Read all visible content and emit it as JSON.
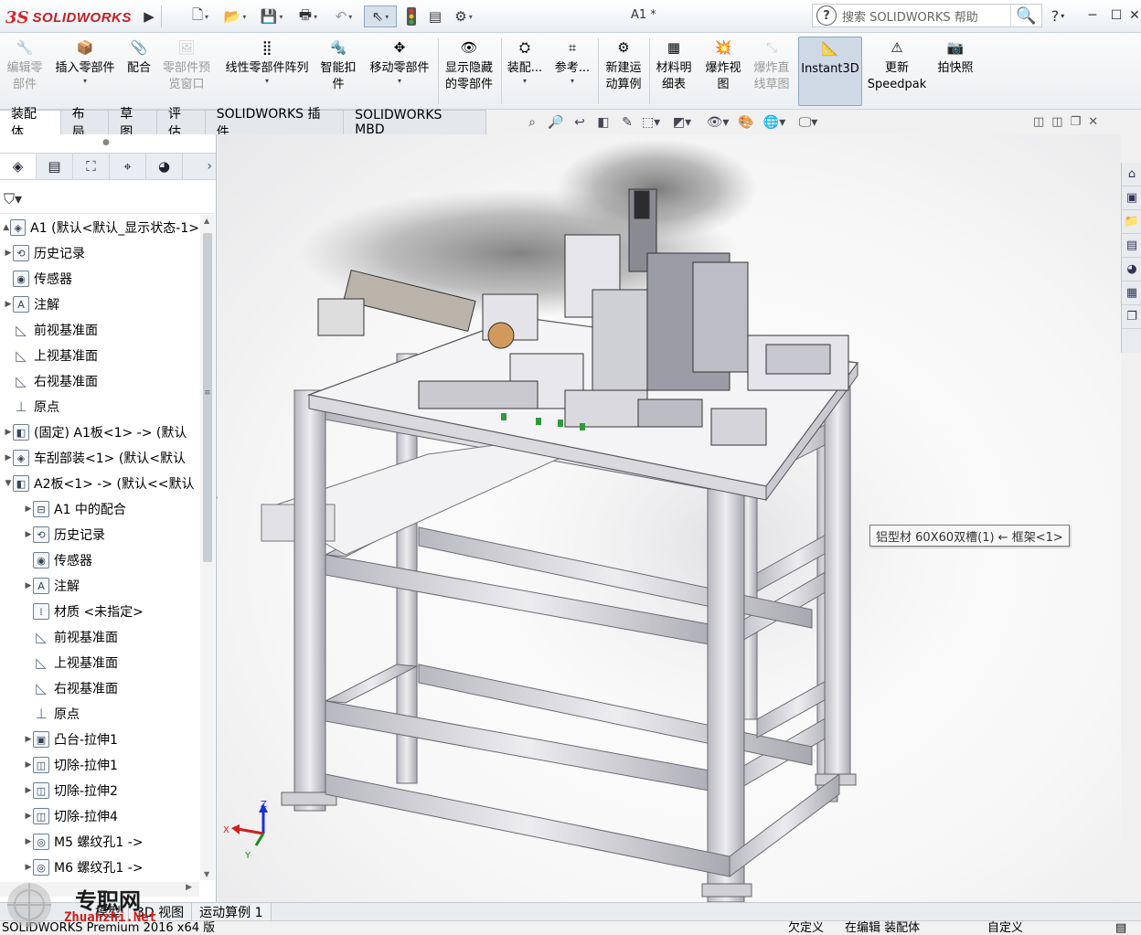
{
  "app": {
    "brand": "SOLIDWORKS",
    "doc_title": "A1 *",
    "search_placeholder": "搜索 SOLIDWORKS 帮助"
  },
  "commands": [
    {
      "id": "edit-component",
      "label": "编辑零\n部件",
      "enabled": false
    },
    {
      "id": "insert-component",
      "label": "插入零部件",
      "enabled": true
    },
    {
      "id": "mate",
      "label": "配合",
      "enabled": true
    },
    {
      "id": "component-preview",
      "label": "零部件预\n览窗口",
      "enabled": false
    },
    {
      "id": "linear-pattern",
      "label": "线性零部件阵列",
      "enabled": true
    },
    {
      "id": "smart-fasteners",
      "label": "智能扣\n件",
      "enabled": true
    },
    {
      "id": "move-component",
      "label": "移动零部件",
      "enabled": true
    },
    {
      "id": "show-hidden",
      "label": "显示隐藏\n的零部件",
      "enabled": true
    },
    {
      "id": "assembly-features",
      "label": "装配...",
      "enabled": true
    },
    {
      "id": "reference-geometry",
      "label": "参考...",
      "enabled": true
    },
    {
      "id": "new-motion-study",
      "label": "新建运\n动算例",
      "enabled": true
    },
    {
      "id": "bom",
      "label": "材料明\n细表",
      "enabled": true
    },
    {
      "id": "exploded-view",
      "label": "爆炸视\n图",
      "enabled": true
    },
    {
      "id": "explode-line-sketch",
      "label": "爆炸直\n线草图",
      "enabled": false
    },
    {
      "id": "instant3d",
      "label": "Instant3D",
      "enabled": true,
      "active": true
    },
    {
      "id": "update-speedpak",
      "label": "更新\nSpeedpak",
      "enabled": true
    },
    {
      "id": "snapshot",
      "label": "拍快照",
      "enabled": true
    }
  ],
  "tabs": [
    "装配体",
    "布局",
    "草图",
    "评估",
    "SOLIDWORKS 插件",
    "SOLIDWORKS MBD"
  ],
  "selected_tab": "装配体",
  "tree": [
    {
      "label": "A1  (默认<默认_显示状态-1>",
      "level": 0,
      "icon": "assembly-icon",
      "toggle": "▲"
    },
    {
      "label": "历史记录",
      "level": 1,
      "icon": "history-icon",
      "toggle": "▶"
    },
    {
      "label": "传感器",
      "level": 1,
      "icon": "sensor-icon",
      "toggle": ""
    },
    {
      "label": "注解",
      "level": 1,
      "icon": "annotation-icon",
      "toggle": "▶"
    },
    {
      "label": "前视基准面",
      "level": 1,
      "icon": "plane-icon",
      "toggle": ""
    },
    {
      "label": "上视基准面",
      "level": 1,
      "icon": "plane-icon",
      "toggle": ""
    },
    {
      "label": "右视基准面",
      "level": 1,
      "icon": "plane-icon",
      "toggle": ""
    },
    {
      "label": "原点",
      "level": 1,
      "icon": "origin-icon",
      "toggle": ""
    },
    {
      "label": "(固定) A1板<1> -> (默认",
      "level": 1,
      "icon": "part-icon",
      "toggle": "▶"
    },
    {
      "label": "车刮部装<1> (默认<默认",
      "level": 1,
      "icon": "subassembly-icon",
      "toggle": "▶"
    },
    {
      "label": "A2板<1> -> (默认<<默认",
      "level": 1,
      "icon": "part-icon",
      "toggle": "▼"
    },
    {
      "label": "A1 中的配合",
      "level": 2,
      "icon": "mates-icon",
      "toggle": "▶"
    },
    {
      "label": "历史记录",
      "level": 2,
      "icon": "history-icon",
      "toggle": "▶"
    },
    {
      "label": "传感器",
      "level": 2,
      "icon": "sensor-icon",
      "toggle": ""
    },
    {
      "label": "注解",
      "level": 2,
      "icon": "annotation-icon",
      "toggle": "▶"
    },
    {
      "label": "材质 <未指定>",
      "level": 2,
      "icon": "material-icon",
      "toggle": ""
    },
    {
      "label": "前视基准面",
      "level": 2,
      "icon": "plane-icon",
      "toggle": ""
    },
    {
      "label": "上视基准面",
      "level": 2,
      "icon": "plane-icon",
      "toggle": ""
    },
    {
      "label": "右视基准面",
      "level": 2,
      "icon": "plane-icon",
      "toggle": ""
    },
    {
      "label": "原点",
      "level": 2,
      "icon": "origin-icon",
      "toggle": ""
    },
    {
      "label": "凸台-拉伸1",
      "level": 2,
      "icon": "extrude-icon",
      "toggle": "▶"
    },
    {
      "label": "切除-拉伸1",
      "level": 2,
      "icon": "cut-icon",
      "toggle": "▶"
    },
    {
      "label": "切除-拉伸2",
      "level": 2,
      "icon": "cut-icon",
      "toggle": "▶"
    },
    {
      "label": "切除-拉伸4",
      "level": 2,
      "icon": "cut-icon",
      "toggle": "▶"
    },
    {
      "label": "M5 螺纹孔1 ->",
      "level": 2,
      "icon": "hole-icon",
      "toggle": "▶"
    },
    {
      "label": "M6 螺纹孔1 ->",
      "level": 2,
      "icon": "hole-icon",
      "toggle": "▶"
    }
  ],
  "tooltip": "铝型材 60X60双槽(1) ← 框架<1>",
  "bottom_tabs": [
    "模型",
    "3D 视图",
    "运动算例 1"
  ],
  "status": {
    "product": "SOLIDWORKS Premium 2016 x64 版",
    "units_left": "欠定义",
    "editing": "在编辑 装配体",
    "custom": "自定义"
  },
  "watermark": {
    "cn": "专职网",
    "en": "Zhuanzhi.Net"
  },
  "triad": {
    "x": "X",
    "y": "Y",
    "z": "Z"
  }
}
